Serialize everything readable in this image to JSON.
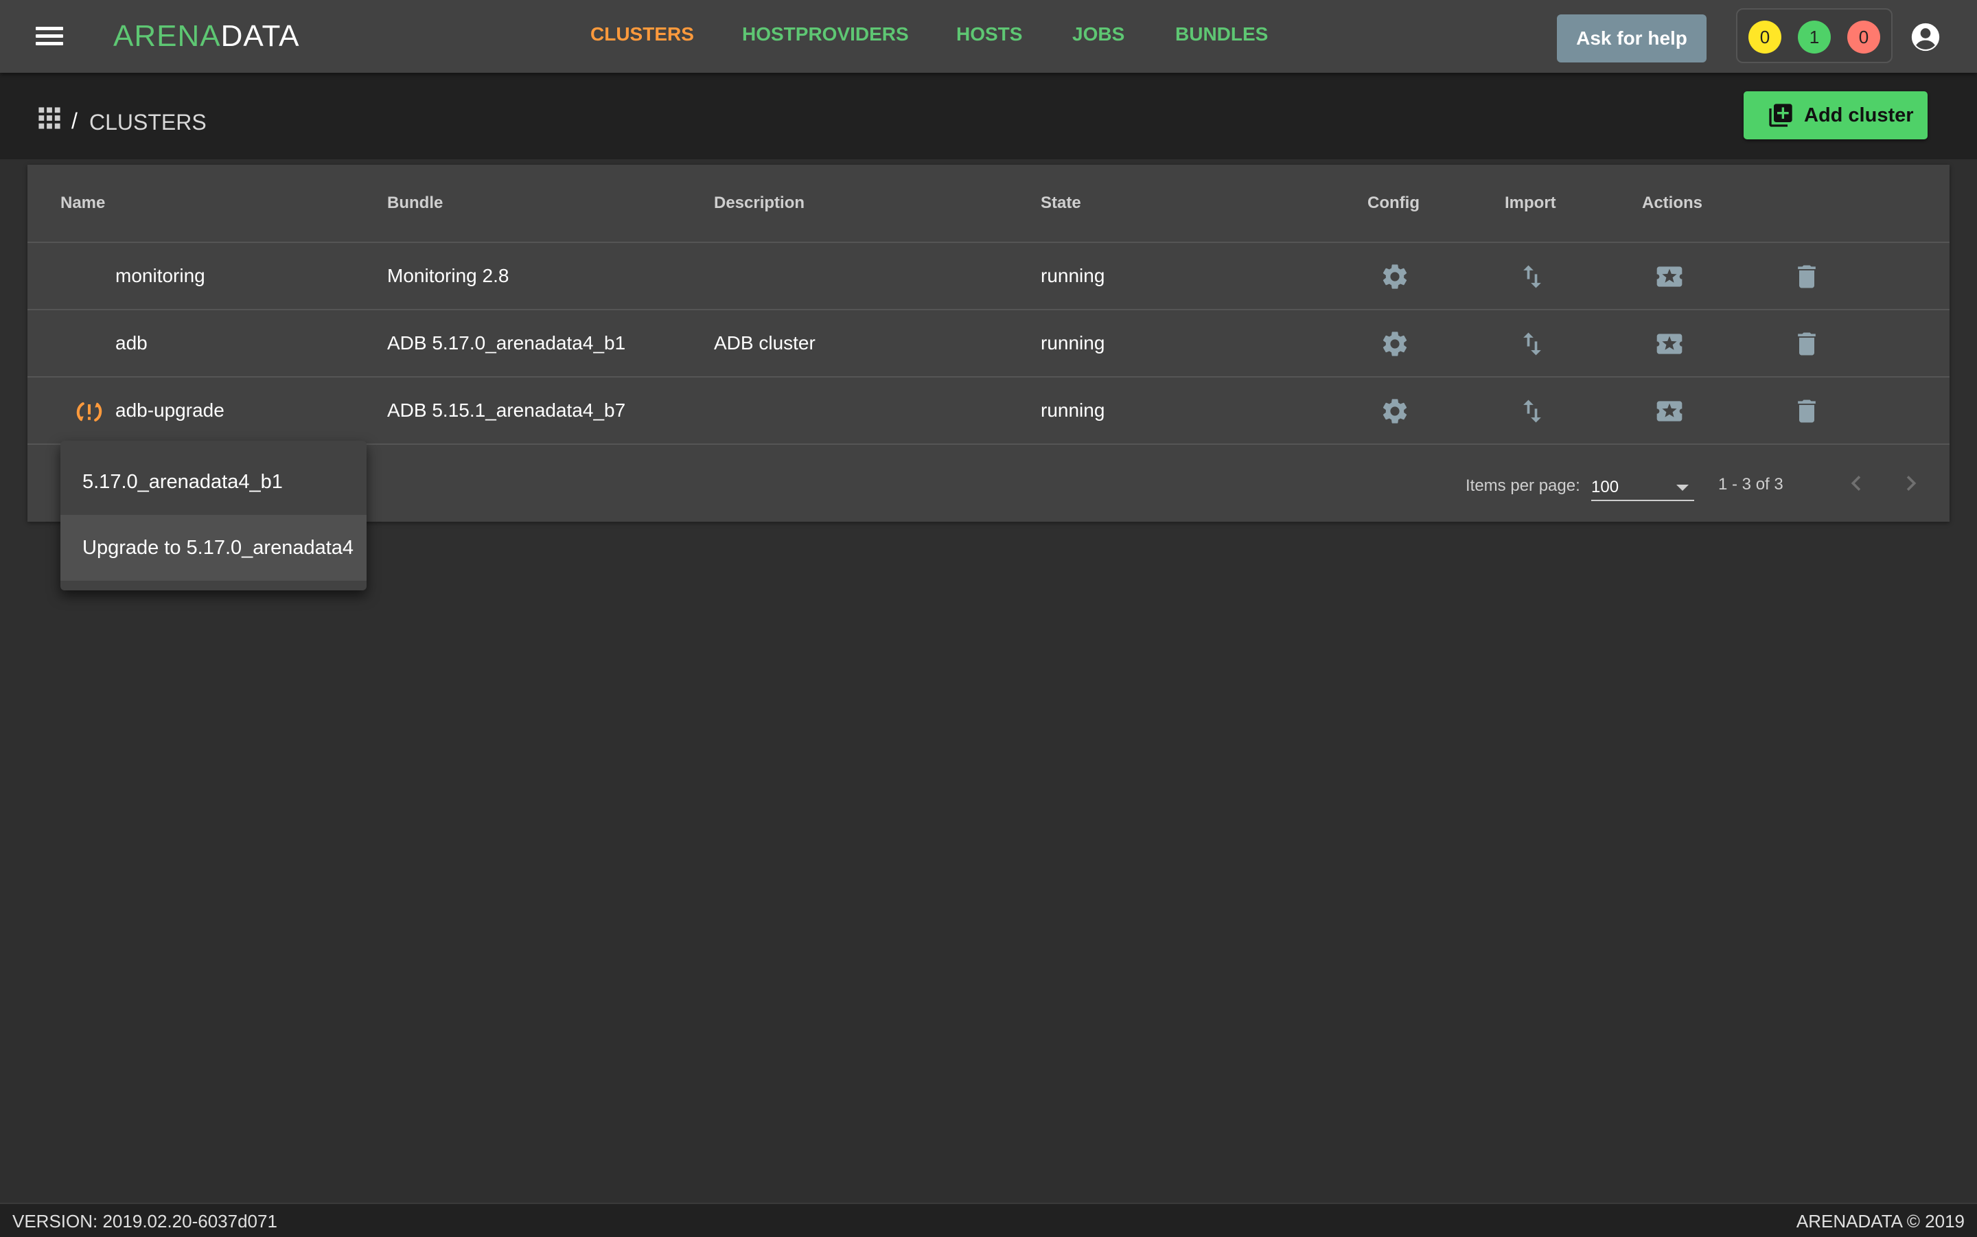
{
  "header": {
    "logo_part1": "ARENA",
    "logo_part2": "DATA",
    "nav": [
      {
        "label": "CLUSTERS",
        "active": true
      },
      {
        "label": "HOSTPROVIDERS",
        "active": false
      },
      {
        "label": "HOSTS",
        "active": false
      },
      {
        "label": "JOBS",
        "active": false
      },
      {
        "label": "BUNDLES",
        "active": false
      }
    ],
    "help_label": "Ask for help",
    "badges": [
      {
        "count": "0",
        "color": "#ffe627"
      },
      {
        "count": "1",
        "color": "#4fd168"
      },
      {
        "count": "0",
        "color": "#ff7a6e"
      }
    ],
    "icons": {
      "menu": "menu-icon",
      "account": "account-circle-icon"
    }
  },
  "breadcrumb": {
    "separator": "/",
    "title": "CLUSTERS",
    "icon": "apps-grid-icon"
  },
  "add_button": {
    "label": "Add cluster",
    "icon": "add-box-icon"
  },
  "table": {
    "columns": [
      "Name",
      "Bundle",
      "Description",
      "State",
      "Config",
      "Import",
      "Actions"
    ],
    "rows": [
      {
        "name": "monitoring",
        "bundle": "Monitoring 2.8",
        "description": "",
        "state": "running",
        "upgrade_available": false
      },
      {
        "name": "adb",
        "bundle": "ADB 5.17.0_arenadata4_b1",
        "description": "ADB cluster",
        "state": "running",
        "upgrade_available": false
      },
      {
        "name": "adb-upgrade",
        "bundle": "ADB 5.15.1_arenadata4_b7",
        "description": "",
        "state": "running",
        "upgrade_available": true
      }
    ],
    "row_icons": [
      "settings-gear-icon",
      "import-export-icon",
      "actions-ticket-icon",
      "delete-trash-icon"
    ]
  },
  "paginator": {
    "items_per_page_label": "Items per page:",
    "items_per_page_value": "100",
    "range_label": "1 - 3 of 3"
  },
  "upgrade_menu": {
    "items": [
      "5.17.0_arenadata4_b1",
      "Upgrade to 5.17.0_arenadata4"
    ]
  },
  "footer": {
    "version": "VERSION: 2019.02.20-6037d071",
    "copyright": "ARENADATA © 2019"
  },
  "colors": {
    "accent_green": "#4fd168",
    "nav_active": "#ff9a3c",
    "upgrade_icon": "#ff9a3c"
  }
}
